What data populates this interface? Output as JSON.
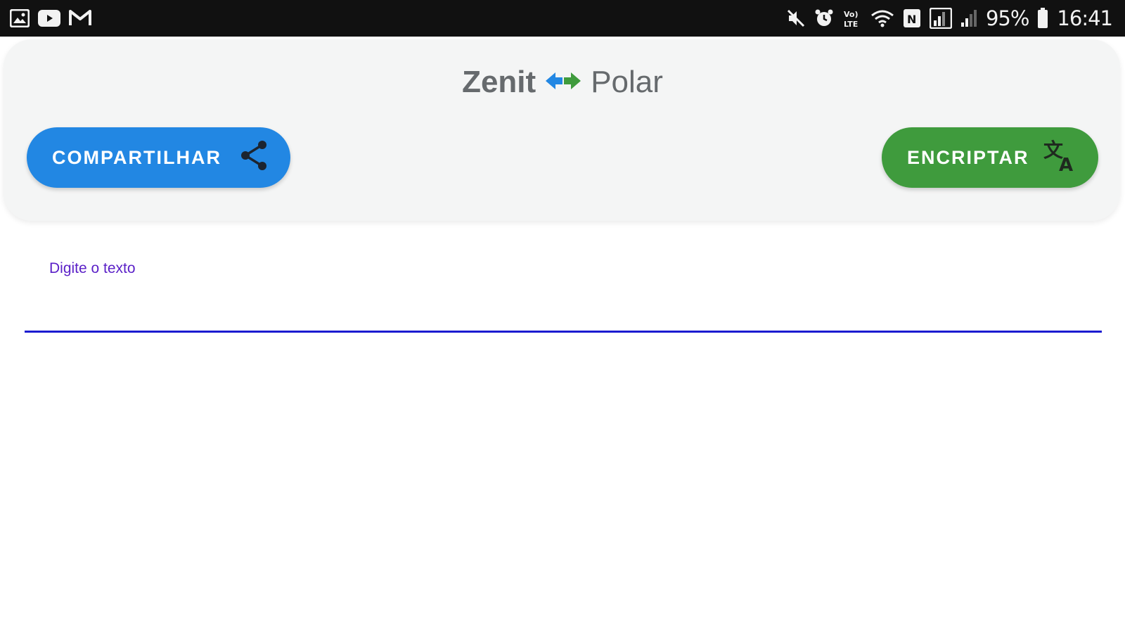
{
  "status_bar": {
    "left_icons": [
      "gallery-icon",
      "youtube-icon",
      "gmail-icon"
    ],
    "right_icons": [
      "mute-icon",
      "alarm-icon",
      "volte-icon",
      "wifi-icon",
      "nfc-icon",
      "data-icon",
      "signal-icon"
    ],
    "battery_text": "95%",
    "time_text": "16:41"
  },
  "header": {
    "title_left": "Zenit",
    "title_right": "Polar",
    "title_icon": "swap-arrows-icon"
  },
  "buttons": {
    "share_label": "COMPARTILHAR",
    "share_icon": "share-icon",
    "share_color": "#2287e3",
    "encrypt_label": "ENCRIPTAR",
    "encrypt_icon": "translate-icon",
    "encrypt_color": "#3f9b3d"
  },
  "input": {
    "label": "Digite o texto",
    "value": "",
    "accent_color": "#1b1bd0"
  }
}
